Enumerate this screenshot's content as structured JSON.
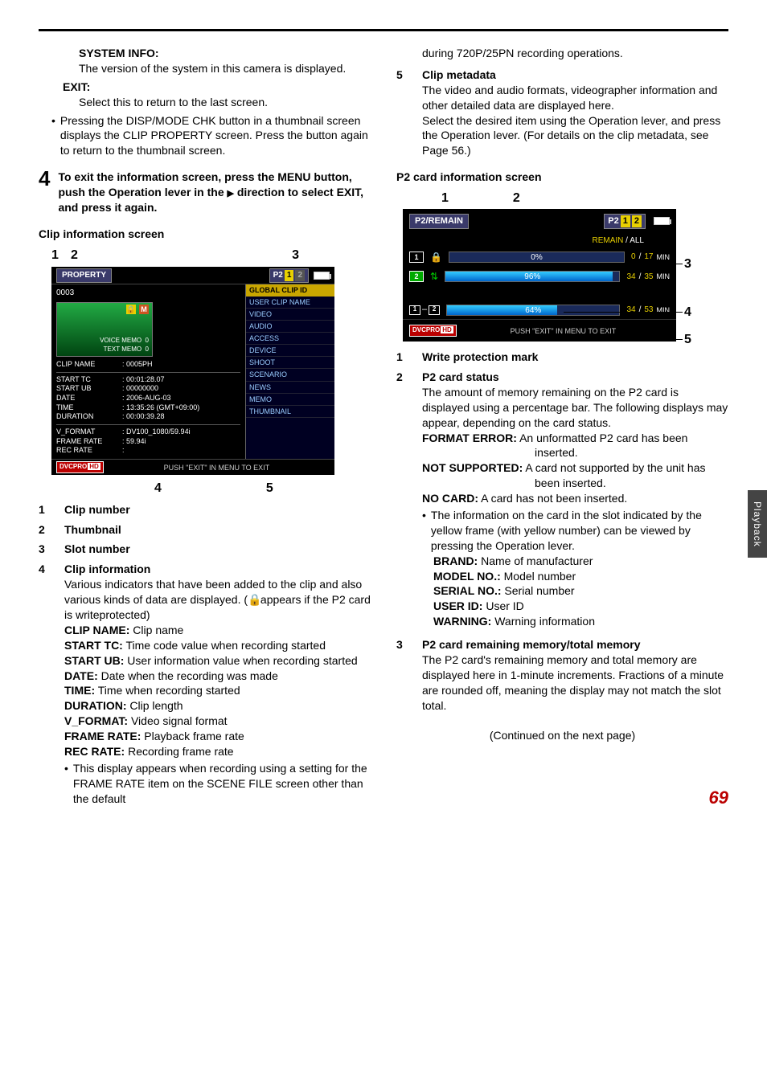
{
  "side_tab": "Playback",
  "page_number": "69",
  "continued": "(Continued on the next page)",
  "left": {
    "system_info_h": "SYSTEM INFO:",
    "system_info_b": "The version of the system in this camera is displayed.",
    "exit_h": "EXIT:",
    "exit_b": "Select this to return to the last screen.",
    "bullet_disp": "Pressing the DISP/MODE CHK button in a thumbnail screen displays the CLIP PROPERTY screen. Press the button again to return to the thumbnail screen.",
    "step4_num": "4",
    "step4_text_a": "To exit the information screen, press the MENU button, push the Operation lever in the ",
    "step4_text_b": " direction to select EXIT, and press it again.",
    "clip_screen_h": "Clip information screen",
    "items": {
      "n1": "1",
      "t1": "Clip number",
      "n2": "2",
      "t2": "Thumbnail",
      "n3": "3",
      "t3": "Slot number",
      "n4": "4",
      "t4": "Clip information",
      "b4a": "Various indicators that have been added to the clip and also various kinds of data are displayed. (",
      "b4b": " appears if the P2 card is writeprotected)",
      "clipname": "CLIP NAME:",
      "clipname_v": " Clip name",
      "starttc": "START TC:",
      "starttc_v": " Time code value when recording started",
      "startub": "START UB:",
      "startub_v": " User information value when recording started",
      "date": "DATE:",
      "date_v": " Date when the recording was made",
      "time": "TIME:",
      "time_v": " Time when recording started",
      "duration": "DURATION:",
      "duration_v": " Clip length",
      "vformat": "V_FORMAT:",
      "vformat_v": " Video signal format",
      "framerate": "FRAME RATE:",
      "framerate_v": " Playback frame rate",
      "recrate": "REC RATE:",
      "recrate_v": " Recording frame rate",
      "recrate_bullet": "This display appears when recording using a setting for the FRAME RATE item on the SCENE FILE screen other than the default"
    },
    "fig": {
      "callout1": "1",
      "callout2": "2",
      "callout3": "3",
      "callout4": "4",
      "callout5": "5",
      "property": "PROPERTY",
      "p2": "P2",
      "slot1": "1",
      "slot2": "2",
      "seq": "0003",
      "voice_memo": "VOICE MEMO",
      "voice_memo_n": "0",
      "text_memo": "TEXT MEMO",
      "text_memo_n": "0",
      "r_global": "GLOBAL CLIP ID",
      "r_user": "USER CLIP NAME",
      "r_video": "VIDEO",
      "r_audio": "AUDIO",
      "r_access": "ACCESS",
      "r_device": "DEVICE",
      "r_shoot": "SHOOT",
      "r_scenario": "SCENARIO",
      "r_news": "NEWS",
      "r_memo": "MEMO",
      "r_thumb": "THUMBNAIL",
      "k_clipname": "CLIP NAME",
      "v_clipname": ": 0005PH",
      "k_starttc": "START TC",
      "v_starttc": ": 00:01:28.07",
      "k_startub": "START UB",
      "v_startub": ": 00000000",
      "k_date": "DATE",
      "v_date": ": 2006-AUG-03",
      "k_time": "TIME",
      "v_time": ": 13:35:26 (GMT+09:00)",
      "k_duration": "DURATION",
      "v_duration": ": 00:00:39.28",
      "k_vformat": "V_FORMAT",
      "v_vformat": ": DV100_1080/59.94i",
      "k_framerate": "FRAME RATE",
      "v_framerate": ": 59.94i",
      "k_recrate": "REC RATE",
      "v_recrate": ":",
      "dvcpro": "DVCPRO",
      "hd": "HD",
      "exitmsg": "PUSH \"EXIT\" IN MENU TO EXIT"
    }
  },
  "right": {
    "cont_line": "during 720P/25PN recording operations.",
    "n5": "5",
    "t5": "Clip metadata",
    "b5a": "The video and audio formats, videographer information and other detailed data are displayed here.",
    "b5b": "Select the desired item using the Operation lever, and press the Operation lever. (For details on the clip metadata, see Page 56.)",
    "p2_screen_h": "P2 card information screen",
    "fig": {
      "c1": "1",
      "c2": "2",
      "c3": "3",
      "c4": "4",
      "c5": "5",
      "p2remain": "P2/REMAIN",
      "p2": "P2",
      "slot1": "1",
      "slot2": "2",
      "remain": "REMAIN",
      "slash": " / ",
      "all": "ALL",
      "row1_slot": "1",
      "row1_pct": "0%",
      "row1_a": "0",
      "row1_b": "17",
      "row1_min": "MIN",
      "row2_slot": "2",
      "row2_pct": "96%",
      "row2_a": "34",
      "row2_b": "35",
      "row2_min": "MIN",
      "row3_slot_a": "1",
      "row3_dash": "–",
      "row3_slot_b": "2",
      "row3_pct": "64%",
      "row3_a": "34",
      "row3_b": "53",
      "row3_min": "MIN",
      "dvcpro": "DVCPRO",
      "hd": "HD",
      "exitmsg": "PUSH \"EXIT\" IN MENU TO EXIT"
    },
    "items": {
      "n1": "1",
      "t1": "Write protection mark",
      "n2": "2",
      "t2": "P2 card status",
      "b2": "The amount of memory remaining on the P2 card is displayed using a percentage bar. The following displays may appear, depending on the card status.",
      "fe": "FORMAT ERROR:",
      "fe_v": " An unformatted P2 card has been inserted.",
      "ns": "NOT SUPPORTED:",
      "ns_v": " A card not supported by the unit has been inserted.",
      "nc": "NO CARD:",
      "nc_v": " A card has not been inserted.",
      "bullet_yellow": "The information on the card in the slot indicated by the yellow frame (with yellow number) can be viewed by pressing the Operation lever.",
      "brand": "BRAND:",
      "brand_v": " Name of manufacturer",
      "model": "MODEL NO.:",
      "model_v": " Model number",
      "serial": "SERIAL NO.:",
      "serial_v": " Serial number",
      "userid": "USER ID:",
      "userid_v": " User ID",
      "warning": "WARNING:",
      "warning_v": " Warning information",
      "n3": "3",
      "t3": "P2 card remaining memory/total memory",
      "b3": "The P2 card's remaining memory and total memory are displayed here in 1-minute increments. Fractions of a minute are rounded off, meaning the display may not match the slot total."
    }
  }
}
